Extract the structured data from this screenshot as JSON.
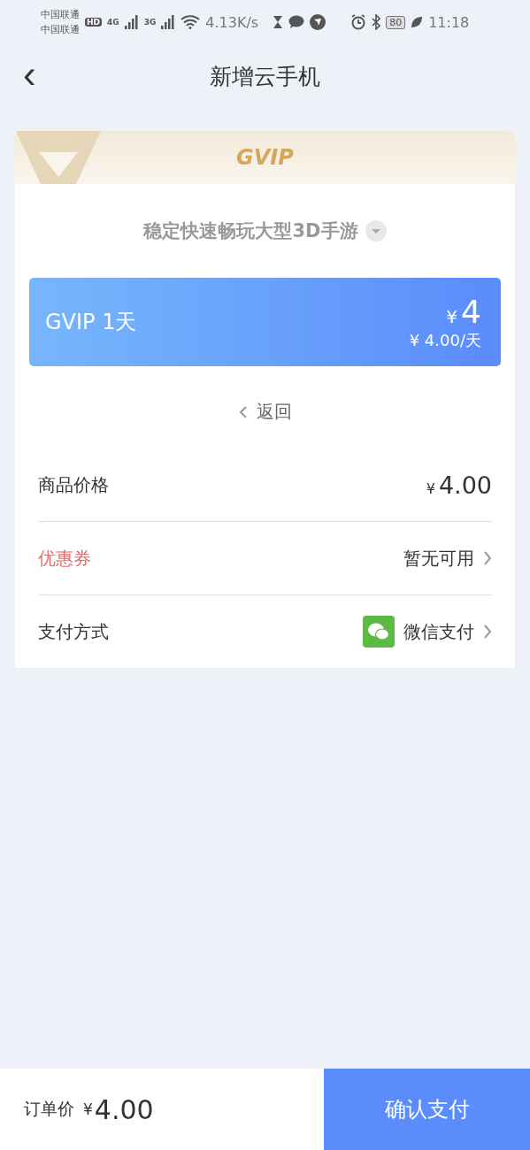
{
  "status_bar": {
    "carriers": [
      "中国联通",
      "中国联通"
    ],
    "hd": "HD",
    "networks": [
      "4G",
      "3G"
    ],
    "speed": "4.13K/s",
    "battery": "80",
    "time": "11:18"
  },
  "header": {
    "back": "‹",
    "title": "新增云手机"
  },
  "banner": {
    "logo": "GVIP"
  },
  "plan_selector": {
    "title": "稳定快速畅玩大型3D手游"
  },
  "plan": {
    "name": "GVIP 1天",
    "currency": "¥",
    "price": "4",
    "per_day": "¥ 4.00/天"
  },
  "back_link": {
    "label": "返回"
  },
  "rows": [
    {
      "kind": "price",
      "label": "商品价格",
      "currency": "¥",
      "value": "4.00"
    },
    {
      "kind": "coupon",
      "label": "优惠券",
      "value": "暂无可用"
    },
    {
      "kind": "payment",
      "label": "支付方式",
      "value": "微信支付"
    }
  ],
  "footer": {
    "label": "订单价",
    "currency": "¥",
    "amount": "4.00",
    "button": "确认支付"
  }
}
